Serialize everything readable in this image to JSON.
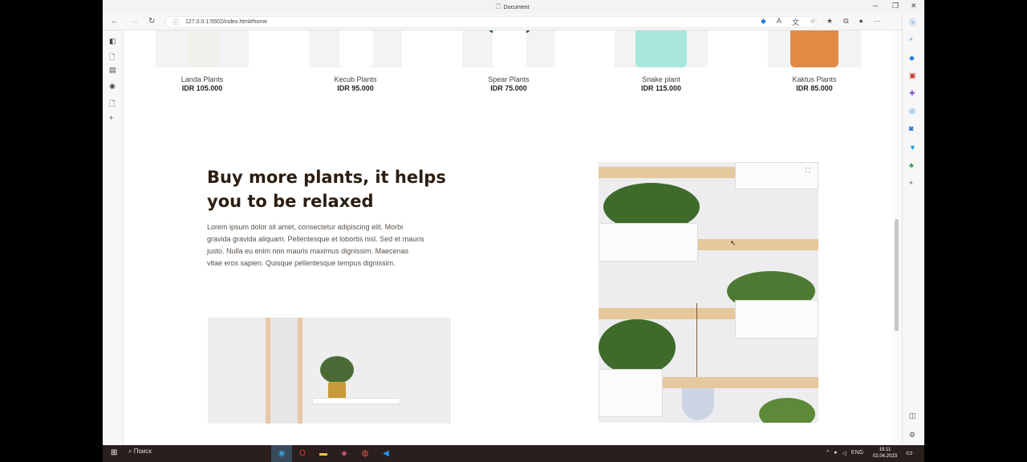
{
  "window": {
    "title": "Document",
    "minimize": "─",
    "restore": "❐",
    "close": "✕"
  },
  "address_bar": {
    "url": "127.0.0.1:5502/index.html#home",
    "back": "←",
    "forward": "→",
    "refresh": "↻",
    "more": "···"
  },
  "products": [
    {
      "name": "Landa Plants",
      "price": "IDR 105.000",
      "pot_color": "#f1f0eb"
    },
    {
      "name": "Kecub Plants",
      "price": "IDR 95.000",
      "pot_color": "#ffffff"
    },
    {
      "name": "Spear Plants",
      "price": "IDR 75.000",
      "pot_color": "#ffffff"
    },
    {
      "name": "Snake plant",
      "price": "IDR 115.000",
      "pot_color": "#a8e6dc"
    },
    {
      "name": "Kaktus Plants",
      "price": "IDR 85.000",
      "pot_color": "#e08a45"
    }
  ],
  "feature": {
    "headline": "Buy more plants, it helps you to be relaxed",
    "body": "Lorem ipsum dolor sit amet, consectetur adipiscing elit. Morbi gravida gravida aliquam. Pellentesque et lobortis nisl. Sed et mauris justo. Nulla eu enim non mauris maximus dignissim. Maecenas vitae eros sapien. Quisque pellentesque tempus dignissim."
  },
  "taskbar": {
    "search": "Поиск",
    "lang": "ENG",
    "time": "19:11",
    "date": "02.04.2023"
  },
  "colors": {
    "headline": "#2b1d10",
    "accent_wood": "#e5c89c",
    "leaf_green": "#3e6a2a"
  }
}
